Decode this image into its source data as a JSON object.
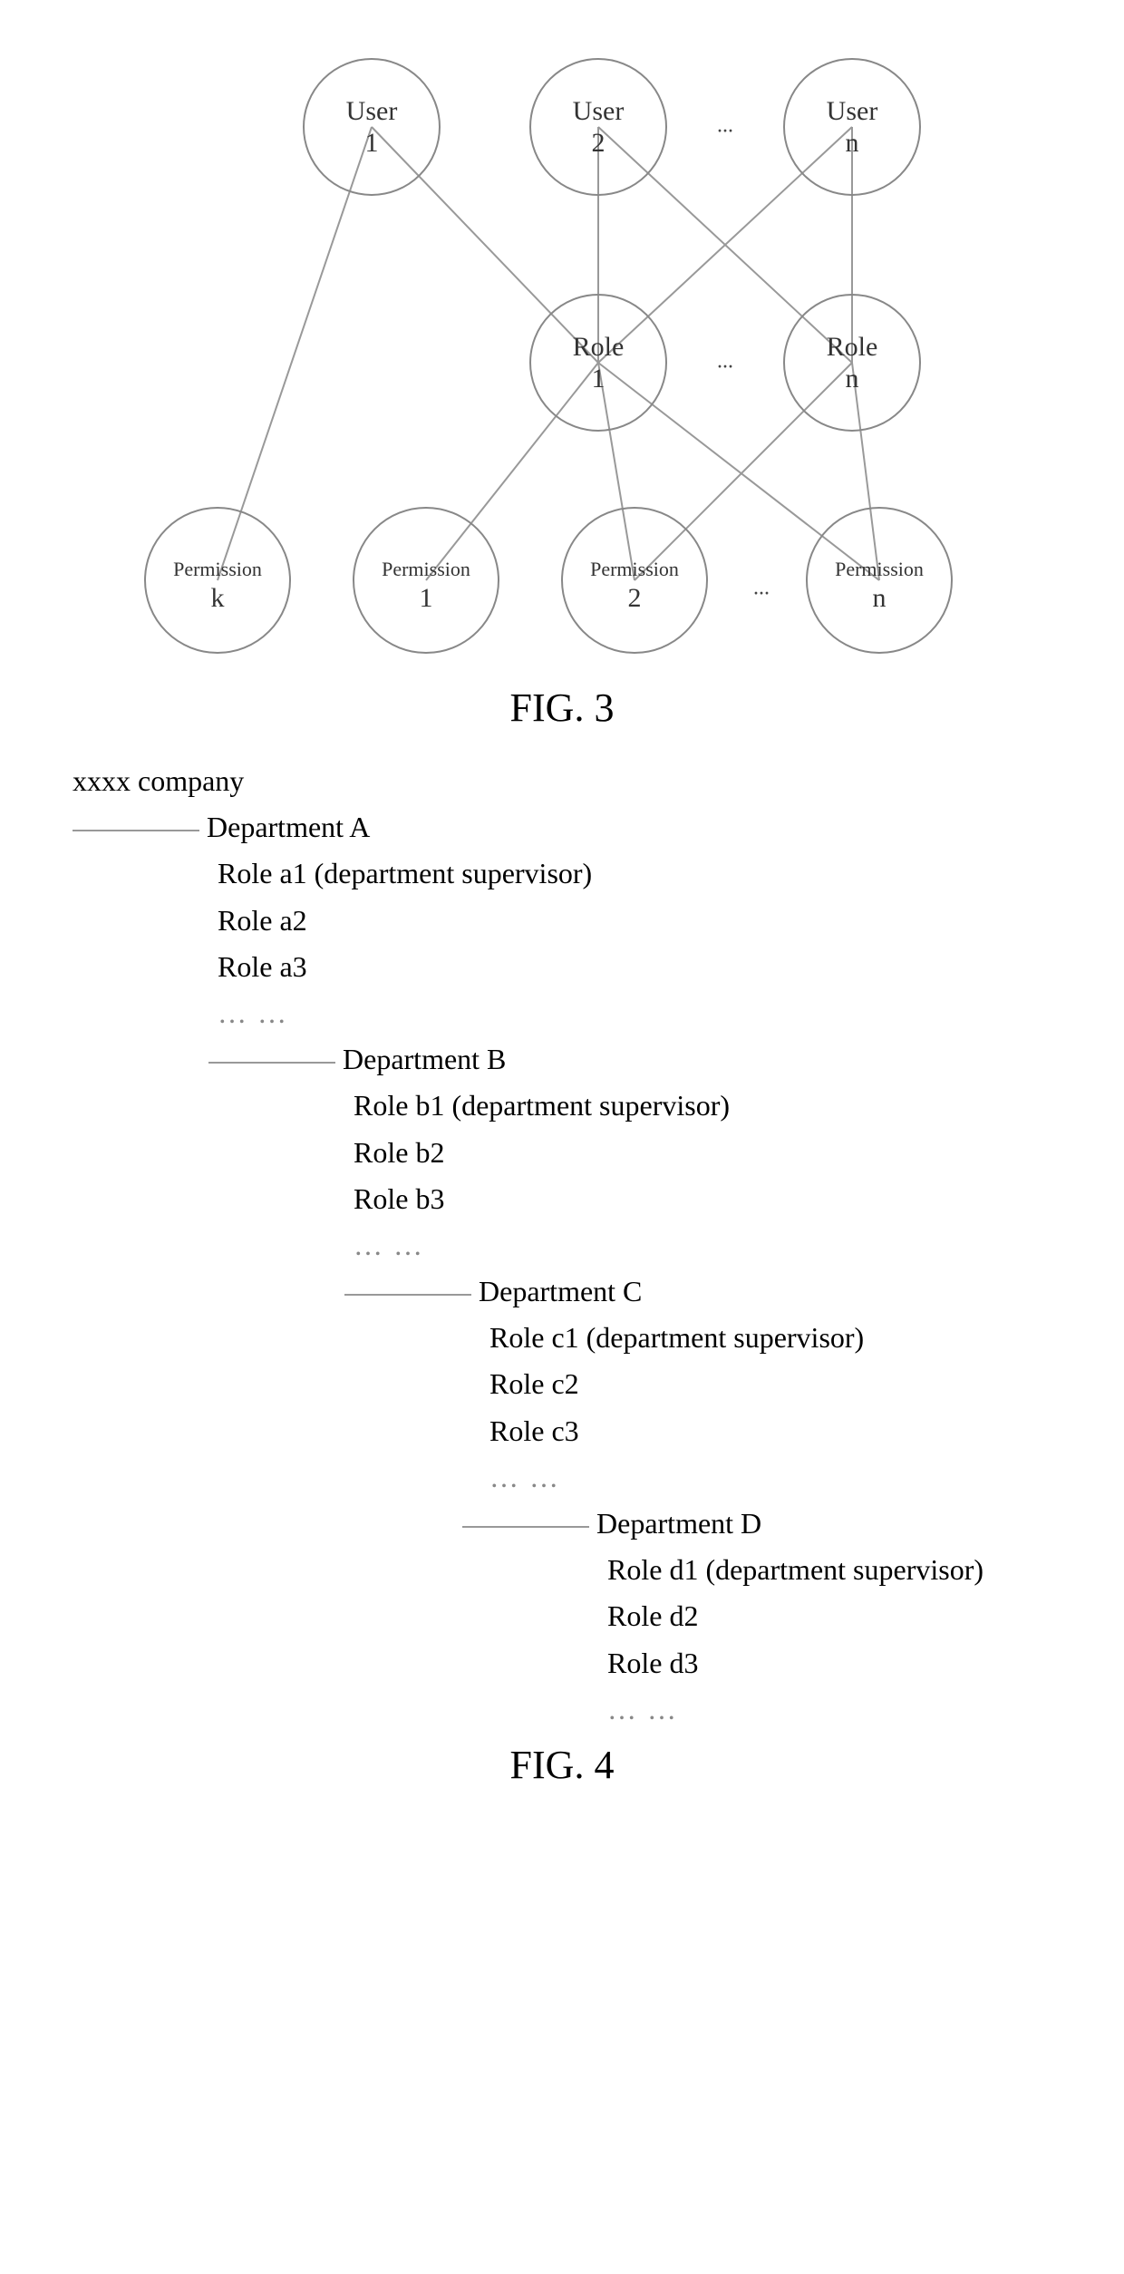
{
  "fig3": {
    "caption": "FIG. 3",
    "nodes": {
      "u1": {
        "line1": "User",
        "line2": "1"
      },
      "u2": {
        "line1": "User",
        "line2": "2"
      },
      "un": {
        "line1": "User",
        "line2": "n"
      },
      "r1": {
        "line1": "Role",
        "line2": "1"
      },
      "rn": {
        "line1": "Role",
        "line2": "n"
      },
      "pk": {
        "line1": "Permission",
        "line2": "k"
      },
      "p1": {
        "line1": "Permission",
        "line2": "1"
      },
      "p2": {
        "line1": "Permission",
        "line2": "2"
      },
      "pn": {
        "line1": "Permission",
        "line2": "n"
      }
    },
    "ellipses": {
      "top": "...",
      "mid": "...",
      "bot": "..."
    }
  },
  "fig4": {
    "caption": "FIG. 4",
    "company": "xxxx company",
    "departments": [
      {
        "name": "Department A",
        "roles": [
          "Role a1 (department supervisor)",
          "Role a2",
          "Role a3"
        ],
        "more": "… …"
      },
      {
        "name": "Department B",
        "roles": [
          "Role b1 (department supervisor)",
          "Role b2",
          "Role b3"
        ],
        "more": "… …"
      },
      {
        "name": "Department C",
        "roles": [
          "Role c1 (department supervisor)",
          "Role c2",
          "Role c3"
        ],
        "more": "… …"
      },
      {
        "name": "Department D",
        "roles": [
          "Role d1 (department supervisor)",
          "Role d2",
          "Role d3"
        ],
        "more": "… …"
      }
    ]
  }
}
